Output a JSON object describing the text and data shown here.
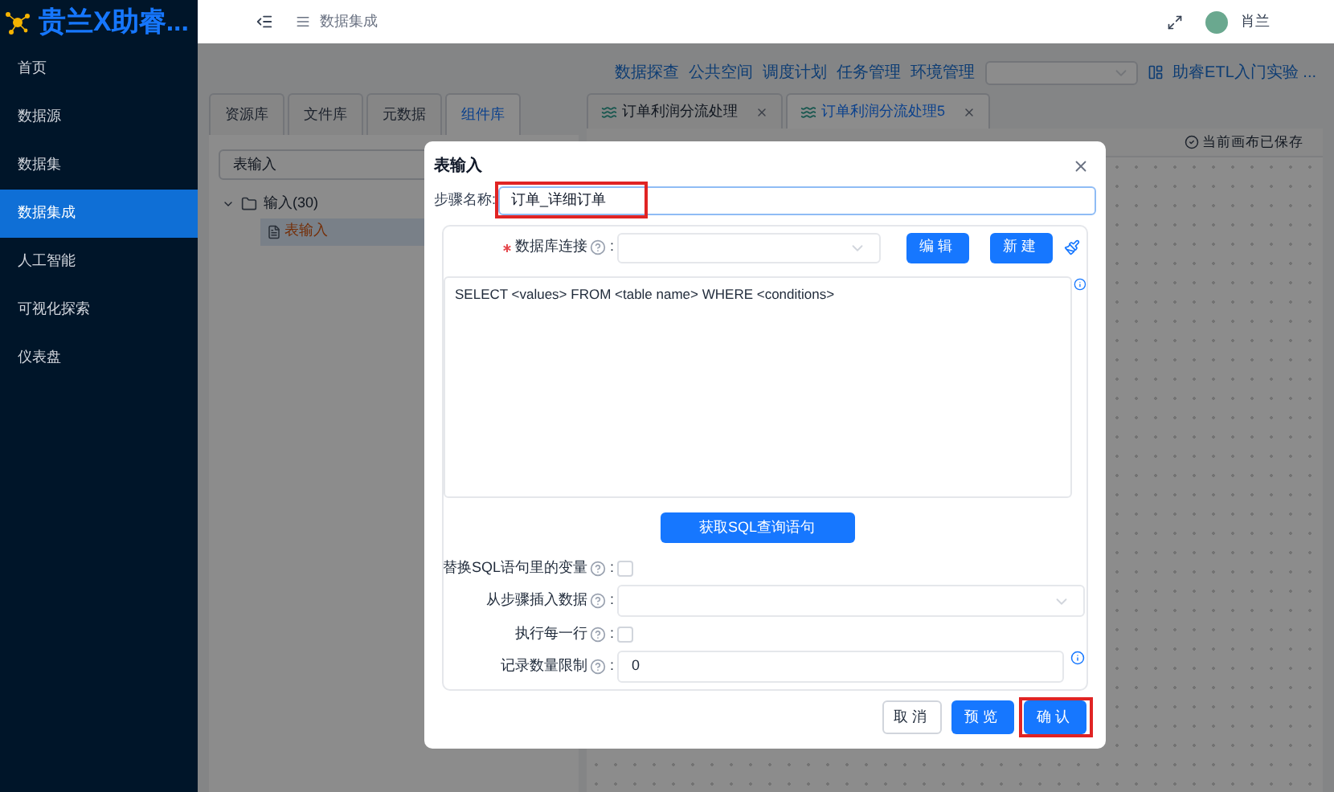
{
  "brand": {
    "title": "贵兰X助睿..."
  },
  "sidebar": {
    "items": [
      {
        "label": "首页",
        "selected": false
      },
      {
        "label": "数据源",
        "selected": false
      },
      {
        "label": "数据集",
        "selected": false
      },
      {
        "label": "数据集成",
        "selected": true
      },
      {
        "label": "人工智能",
        "selected": false
      },
      {
        "label": "可视化探索",
        "selected": false
      },
      {
        "label": "仪表盘",
        "selected": false
      }
    ]
  },
  "header": {
    "breadcrumb": "数据集成",
    "user": "肖兰"
  },
  "top_nav": {
    "links": [
      "数据探查",
      "公共空间",
      "调度计划",
      "任务管理",
      "环境管理"
    ],
    "project": "助睿ETL入门实验 ..."
  },
  "library_tabs": [
    {
      "label": "资源库",
      "selected": false
    },
    {
      "label": "文件库",
      "selected": false
    },
    {
      "label": "元数据",
      "selected": false
    },
    {
      "label": "组件库",
      "selected": true
    }
  ],
  "search": {
    "value": "表输入"
  },
  "tree": [
    {
      "label": "输入(30)",
      "expanded": true,
      "children": [
        {
          "label": "表输入",
          "selected": true
        }
      ]
    }
  ],
  "canvas_tabs": [
    {
      "label": "订单利润分流处理",
      "selected": false
    },
    {
      "label": "订单利润分流处理5",
      "selected": true
    }
  ],
  "save_status": "当前画布已保存",
  "dialog": {
    "title": "表输入",
    "step_name": {
      "label": "步骤名称:",
      "value": "订单_详细订单",
      "highlighted": true
    },
    "db_connection": {
      "label": "数据库连接",
      "colon": ":",
      "required": true,
      "buttons": [
        "编辑",
        "新建"
      ]
    },
    "sql": {
      "value": "SELECT <values> FROM <table name> WHERE <conditions>"
    },
    "fetch_button": "获取SQL查询语句",
    "options": [
      {
        "kind": "checkbox",
        "label": "替换SQL语句里的变量",
        "colon": ":",
        "checked": false
      },
      {
        "kind": "select",
        "label": "从步骤插入数据",
        "colon": ":"
      },
      {
        "kind": "checkbox",
        "label": "执行每一行",
        "colon": ":",
        "checked": false
      },
      {
        "kind": "input",
        "label": "记录数量限制",
        "colon": ":",
        "value": "0"
      }
    ],
    "buttons": [
      {
        "label": "取消",
        "kind": "default",
        "highlighted": false
      },
      {
        "label": "预览",
        "kind": "primary",
        "highlighted": false
      },
      {
        "label": "确认",
        "kind": "primary",
        "highlighted": true
      }
    ]
  }
}
